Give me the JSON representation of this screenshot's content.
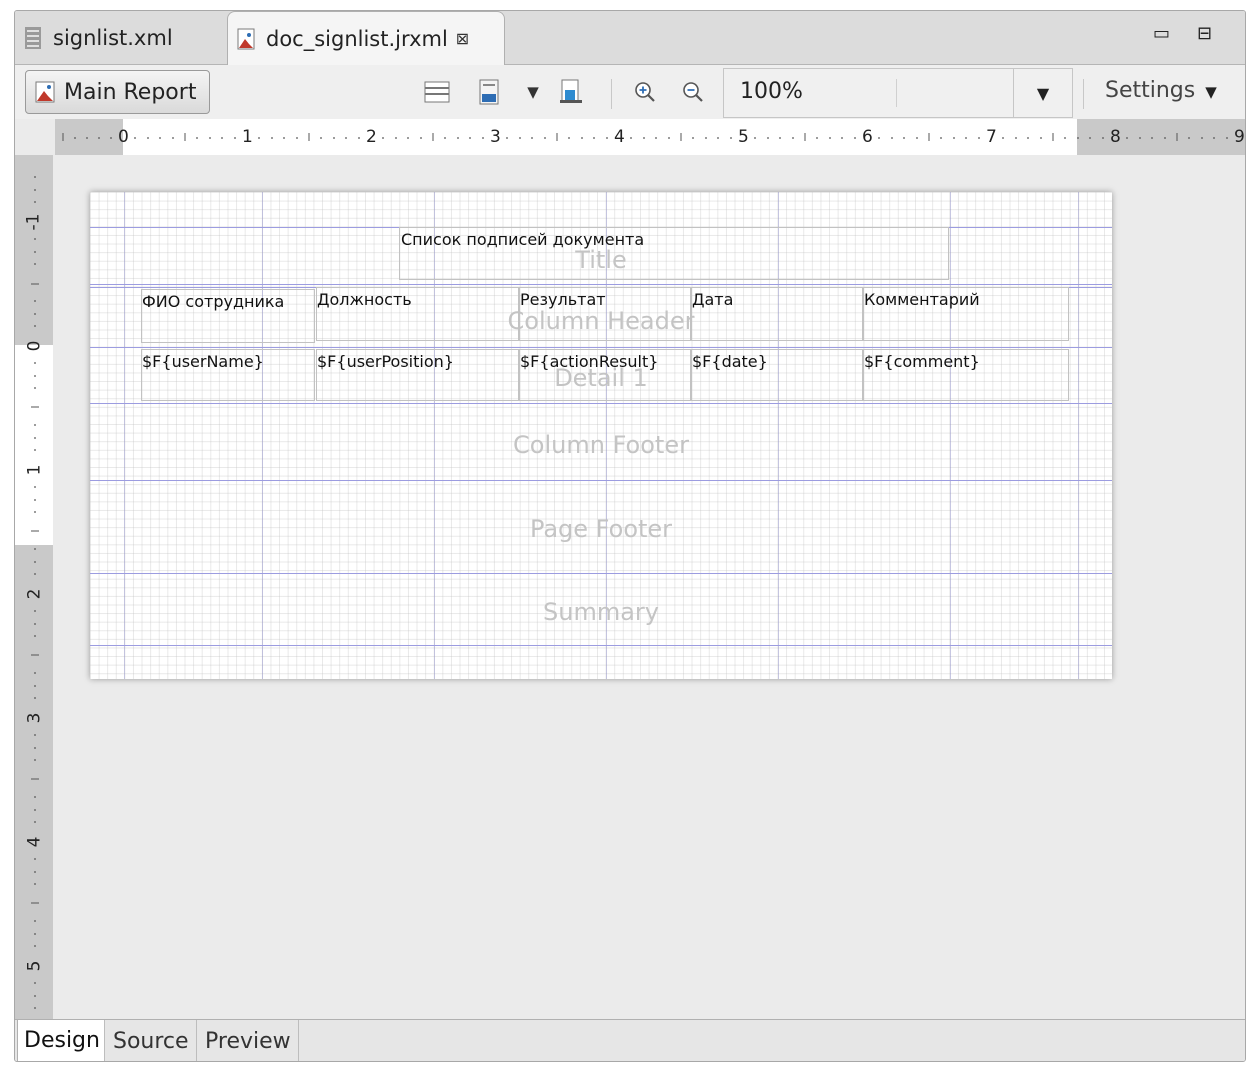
{
  "tabs": [
    {
      "label": "signlist.xml",
      "icon": "text-file-icon"
    },
    {
      "label": "doc_signlist.jrxml",
      "icon": "report-file-icon",
      "close": "⊠"
    }
  ],
  "window_controls": {
    "minimize": "▭",
    "maximize": "⊟"
  },
  "toolbar": {
    "main_report_label": "Main Report",
    "zoom_value": "100%",
    "settings_label": "Settings",
    "icons": [
      "band-layout-icon",
      "dataset-icon",
      "dropdown-arrow-icon",
      "compile-report-icon",
      "zoom-in-icon",
      "zoom-out-icon"
    ]
  },
  "ruler_h": [
    "0",
    "1",
    "2",
    "3",
    "4",
    "5",
    "6",
    "7",
    "8",
    "9"
  ],
  "ruler_v": [
    "-1",
    "0",
    "1",
    "2",
    "3",
    "4",
    "5"
  ],
  "report": {
    "title_text": "Список подписей документа",
    "bands": {
      "title": "Title",
      "column_header": "Column Header",
      "detail": "Detail 1",
      "column_footer": "Column Footer",
      "page_footer": "Page Footer",
      "summary": "Summary"
    },
    "column_headers": [
      "ФИО сотрудника",
      "Должность",
      "Результат",
      "Дата",
      "Комментарий"
    ],
    "detail_fields": [
      "$F{userName}",
      "$F{userPosition}",
      "$F{actionResult}",
      "$F{date}",
      "$F{comment}"
    ]
  },
  "bottom_tabs": [
    "Design",
    "Source",
    "Preview"
  ],
  "colors": {
    "band_line": "#9c9ce0",
    "band_label": "#c4c4c4",
    "ruler_grey": "#c9c9c9"
  }
}
